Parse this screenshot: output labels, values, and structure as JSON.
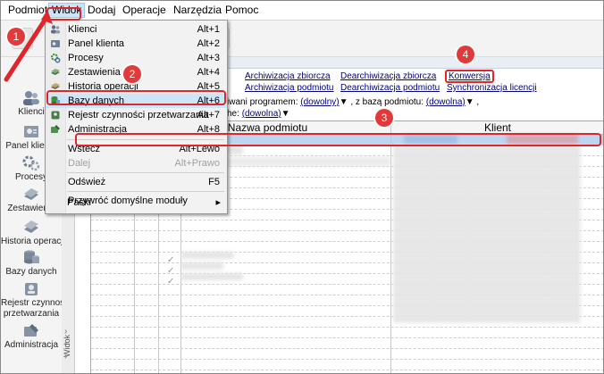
{
  "menubar": {
    "items": [
      {
        "label": "Podmiot"
      },
      {
        "label": "Widok"
      },
      {
        "label": "Dodaj"
      },
      {
        "label": "Operacje"
      },
      {
        "label": "Narzędzia"
      },
      {
        "label": "Pomoc"
      }
    ],
    "active": "Widok"
  },
  "view_menu": {
    "items": [
      {
        "label": "Klienci",
        "shortcut": "Alt+1",
        "icon": "clients-icon"
      },
      {
        "label": "Panel klienta",
        "shortcut": "Alt+2",
        "icon": "client-panel-icon"
      },
      {
        "label": "Procesy",
        "shortcut": "Alt+3",
        "icon": "processes-icon"
      },
      {
        "label": "Zestawienia",
        "shortcut": "Alt+4",
        "icon": "reports-icon"
      },
      {
        "label": "Historia operacji",
        "shortcut": "Alt+5",
        "icon": "history-icon"
      },
      {
        "label": "Bazy danych",
        "shortcut": "Alt+6",
        "icon": "database-icon"
      },
      {
        "label": "Rejestr czynności przetwarzania",
        "shortcut": "Alt+7",
        "icon": "register-icon"
      },
      {
        "label": "Administracja",
        "shortcut": "Alt+8",
        "icon": "admin-icon"
      },
      {
        "label": "Wstecz",
        "shortcut": "Alt+Lewo"
      },
      {
        "label": "Dalej",
        "shortcut": "Alt+Prawo"
      },
      {
        "label": "Odśwież",
        "shortcut": "F5"
      },
      {
        "label": "Przywróć domyślne moduły"
      },
      {
        "label": "Paski",
        "arrow": "▸"
      }
    ]
  },
  "leftnav": {
    "items": [
      {
        "label": "Klienci",
        "icon": "clients-icon"
      },
      {
        "label": "Panel klienta",
        "icon": "client-panel-icon"
      },
      {
        "label": "Procesy",
        "icon": "processes-icon"
      },
      {
        "label": "Zestawienia",
        "icon": "reports-icon"
      },
      {
        "label": "Historia operacji",
        "icon": "history-icon"
      },
      {
        "label": "Bazy danych",
        "icon": "database-icon"
      },
      {
        "label": "Rejestr czynności",
        "label2": "przetwarzania",
        "icon": "register-icon"
      },
      {
        "label": "Administracja",
        "icon": "admin-icon"
      }
    ],
    "side_label": "Widok"
  },
  "links": {
    "archiwizacja_zbiorcza": "Archiwizacja zbiorcza",
    "archiwizacja_podmiotu": "Archiwizacja podmiotu",
    "dearchiwizacja_zbiorcza": "Dearchiwizacja zbiorcza",
    "dearchiwizacja_podmiotu": "Dearchiwizacja podmiotu",
    "konwersja": "Konwersja",
    "synchronizacja": "Synchronizacja licencji"
  },
  "filters": {
    "line1_prefix": "iwani programem:",
    "program_value": "(dowolny)",
    "line1_mid": ", z bazą podmiotu:",
    "base_value": "(dowolna)",
    "line1_suffix": ",",
    "line2_prefix": "he:",
    "line2_value": "(dowolna)",
    "dropdown_glyph": "▼"
  },
  "grid": {
    "columns": [
      "Nazwa podmiotu",
      "Klient"
    ],
    "check_glyph": "✓"
  },
  "annotations": {
    "c1": "1",
    "c2": "2",
    "c3": "3",
    "c4": "4"
  },
  "colors": {
    "accent_red": "#e0262b",
    "selection": "#cde6f7",
    "link": "#000080"
  }
}
